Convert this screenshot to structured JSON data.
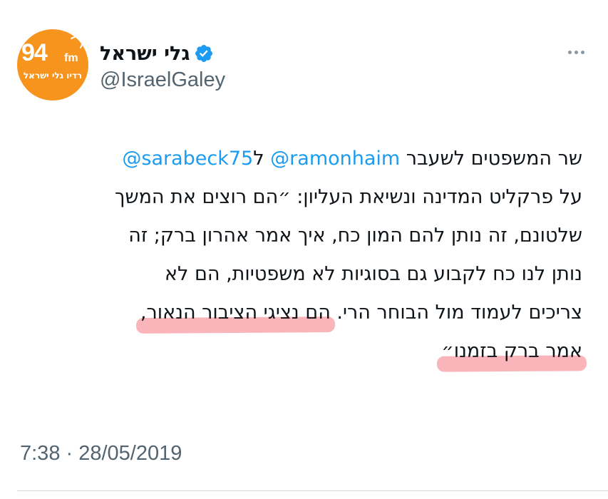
{
  "author": {
    "display_name": "גלי ישראל",
    "handle": "@IsraelGaley",
    "avatar": {
      "logo_number": "94",
      "logo_suffix": "fm",
      "logo_subtitle": "רדיו גלי ישראל",
      "color": "#f7941d"
    },
    "verified": true,
    "verified_color": "#1d9bf0"
  },
  "more_icon": "more-horizontal-icon",
  "tweet": {
    "line1": {
      "pre": "שר המשפטים לשעבר ",
      "mention1": "@ramonhaim",
      "mid": " ל",
      "mention2": "@sarabeck75"
    },
    "line2": "על פרקליט המדינה ונשיאת העליון: ״הם רוצים את המשך",
    "line3": "שלטונם, זה נותן להם המון כח, איך אמר אהרון ברק; זה",
    "line4": "נותן לנו כח לקבוע גם בסוגיות לא משפטיות, הם לא",
    "line5": {
      "pre": "צריכים לעמוד מול הבוחר הרי. ",
      "highlight": "הם נציגי הציבור הנאור,"
    },
    "line6": {
      "highlight": "אמר ברק בזמנו״"
    }
  },
  "highlight_color": "#f67884",
  "timestamp": "7:38 · 28/05/2019"
}
